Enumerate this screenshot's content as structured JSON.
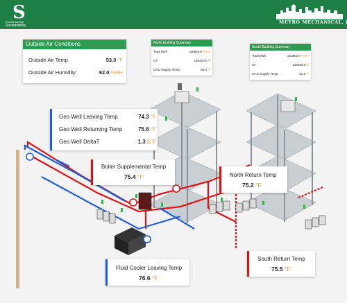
{
  "header": {
    "left_logo": {
      "mark": "S",
      "line1": "Environmental",
      "line2": "Sustainability"
    },
    "right_logo": {
      "text": "METRO MECHANICAL, INC."
    }
  },
  "outside_air": {
    "title": "Outside Air Conditions",
    "rows": [
      {
        "label": "Outside Air Temp",
        "value": "53.3",
        "unit": "°F"
      },
      {
        "label": "Outside Air Humidity",
        "value": "92.0",
        "unit": "%RH"
      }
    ]
  },
  "north_summary": {
    "title": "North Building Summary",
    "rows": [
      {
        "label": "Total kWh",
        "value": "318525.9",
        "unit": "kWHr"
      },
      {
        "label": "CF",
        "value": "193420.0",
        "unit": "ft³"
      },
      {
        "label": "OAU Supply Temp",
        "value": "55.4",
        "unit": "°F"
      }
    ]
  },
  "south_summary": {
    "title": "South Building Summary",
    "rows": [
      {
        "label": "Total kWh",
        "value": "316802.7",
        "unit": "kWHr"
      },
      {
        "label": "CF",
        "value": "140480.0",
        "unit": "ft³"
      },
      {
        "label": "OAU Supply Temp",
        "value": "61.8",
        "unit": "°F"
      }
    ]
  },
  "geo_well": {
    "rows": [
      {
        "label": "Geo Well Leaving Temp",
        "value": "74.3",
        "unit": "°F"
      },
      {
        "label": "Geo Well Returning Temp",
        "value": "75.6",
        "unit": "°F"
      },
      {
        "label": "Geo Well DeltaT",
        "value": "1.3",
        "unit": "Δ°F"
      }
    ]
  },
  "boiler_supplemental": {
    "label": "Boiler Supplemental Temp",
    "value": "75.4",
    "unit": "°F"
  },
  "north_return": {
    "label": "North Return Temp",
    "value": "75.2",
    "unit": "°F"
  },
  "south_return": {
    "label": "South Return Temp",
    "value": "75.5",
    "unit": "°F"
  },
  "fluid_cooler": {
    "label": "Fluid Cooler Leaving Temp",
    "value": "76.6",
    "unit": "°F"
  },
  "colors": {
    "brand_green": "#1e7f45",
    "header_green": "#2e9a52",
    "supply_red": "#d11",
    "return_blue": "#1e5fd6",
    "unit_orange": "#e0a53a"
  }
}
